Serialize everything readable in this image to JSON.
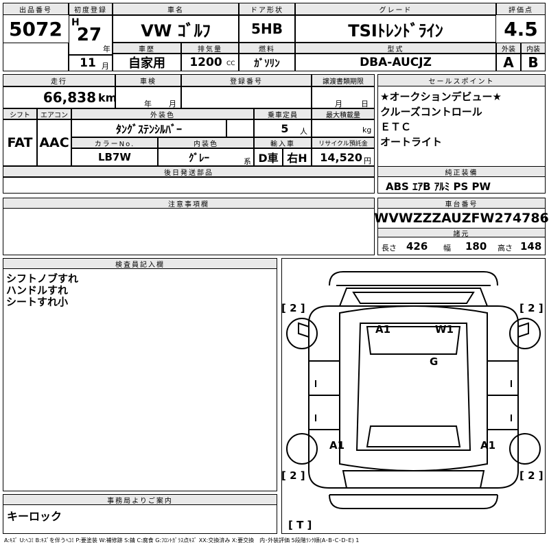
{
  "listing": {
    "lot_header": "出品番号",
    "lot_number": "5072",
    "first_reg_header": "初度登録",
    "era": "H",
    "year": "27",
    "year_unit": "年",
    "month": "11",
    "month_unit": "月",
    "car_name_header": "車名",
    "car_name": "VW ｺﾞﾙﾌ",
    "door_header": "ドア形状",
    "door": "5HB",
    "grade_header": "グレード",
    "grade": "TSIﾄﾚﾝﾄﾞﾗｲﾝ",
    "score_header": "評価点",
    "score": "4.5",
    "history_header": "車歴",
    "history": "自家用",
    "displacement_header": "排気量",
    "displacement": "1200",
    "displacement_unit": "CC",
    "fuel_header": "燃料",
    "fuel": "ｶﾞｿﾘﾝ",
    "model_header": "型式",
    "model": "DBA-AUCJZ",
    "exterior_header": "外装",
    "exterior": "A",
    "interior_header": "内装",
    "interior": "B"
  },
  "row2": {
    "mileage_header": "走行",
    "mileage": "66,838",
    "mileage_unit": "km",
    "inspection_header": "車検",
    "insp_year_unit": "年",
    "insp_month_unit": "月",
    "reg_no_header": "登録番号",
    "reg_no": "",
    "transfer_header": "譲渡書類期限",
    "transfer_month_unit": "月",
    "transfer_day_unit": "日",
    "shift_header": "シフト",
    "shift": "FAT",
    "ac_header": "エアコン",
    "ac": "AAC",
    "color_header": "外装色",
    "color": "ﾀﾝｸﾞｽﾃﾝｼﾙﾊﾞｰ",
    "capacity_header": "乗車定員",
    "capacity": "5",
    "capacity_unit": "人",
    "load_header": "最大積載量",
    "load_unit": "kg",
    "color_no_header": "カラーNo.",
    "color_no": "LB7W",
    "int_color_header": "内装色",
    "int_color": "ｸﾞﾚｰ",
    "int_color_unit": "系",
    "import_header": "輸入車",
    "import": "D車",
    "steering": "右H",
    "recycle_header": "リサイクル預託金",
    "recycle": "14,520",
    "recycle_unit": "円",
    "later_parts_header": "後日発送部品"
  },
  "sales_points": {
    "header": "セールスポイント",
    "items": [
      "★オークションデビュー★",
      "クルーズコントロール",
      "ＥＴＣ",
      "オートライト"
    ]
  },
  "equipment": {
    "header": "純正装備",
    "value": "ABS ｴｱB ｱﾙﾐ PS PW"
  },
  "notes": {
    "header": "注意事項欄"
  },
  "chassis": {
    "header": "車台番号",
    "number": "WVWZZZAUZFW274786",
    "dims_header": "諸元",
    "length_label": "長さ",
    "length": "426",
    "width_label": "幅",
    "width": "180",
    "height_label": "高さ",
    "height": "148"
  },
  "inspector": {
    "header": "検査員記入欄",
    "lines": [
      "シフトノブすれ",
      "ハンドルすれ",
      "シートすれ小"
    ]
  },
  "office": {
    "header": "事務局よりご案内",
    "value": "キーロック"
  },
  "diagram": {
    "tyre_fl": "[ 2 ]",
    "tyre_fr": "[ 2 ]",
    "tyre_rl": "[ 2 ]",
    "tyre_rr": "[ 2 ]",
    "tyre_spare": "[ T ]",
    "mark_roof_l": "A1",
    "mark_roof_r": "W1",
    "mark_glass": "G",
    "mark_rear_l": "A1",
    "mark_rear_r": "A1"
  },
  "footer": "A:ｷｽﾞ U:ﾍｺﾐ B:ｷｽﾞを伴うﾍｺﾐ P:要塗装 W:補修跡 S:錆 C:腐食 G:ﾌﾛﾝﾄｶﾞﾗｽ点ｷｽﾞ XX:交換済み X:要交換　内･外装評価 5段階ﾗﾝｸ順(A･B･C･D･E) 1"
}
